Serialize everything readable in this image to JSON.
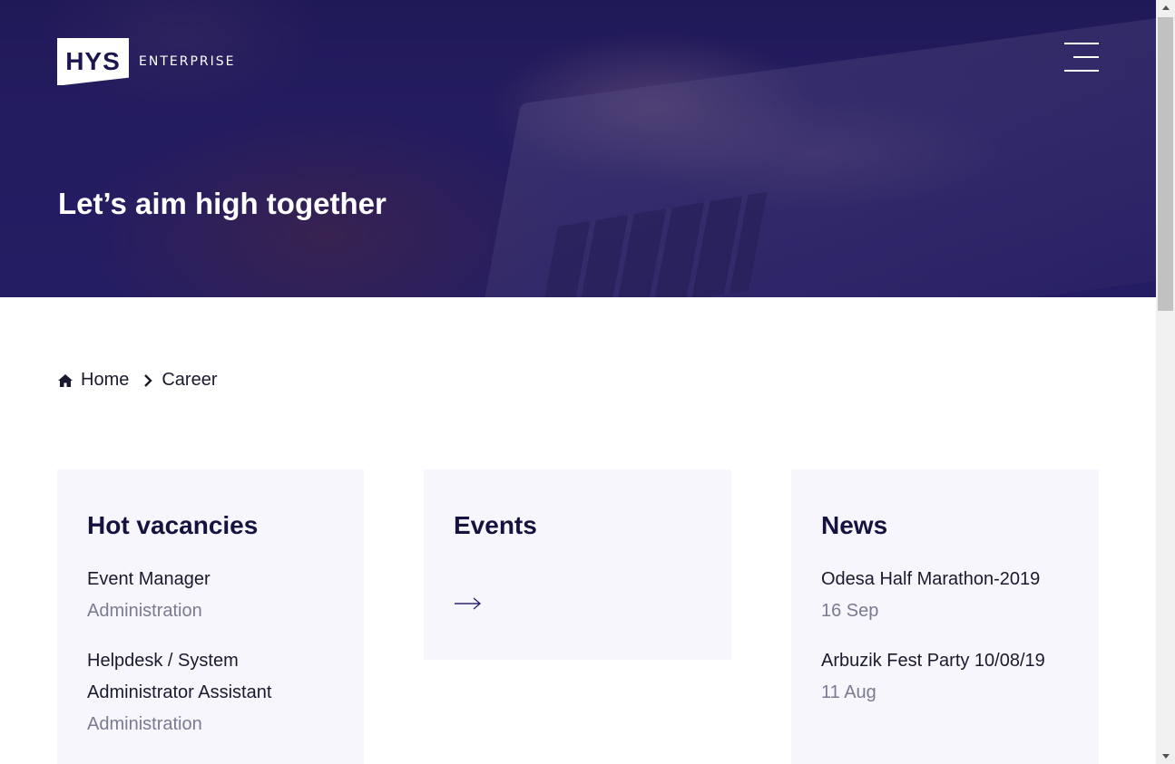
{
  "header": {
    "logo_mark": "HYS",
    "logo_text": "ENTERPRISE",
    "hero_title": "Let’s aim high together"
  },
  "breadcrumb": {
    "home_label": "Home",
    "current_label": "Career"
  },
  "vacancies": {
    "title": "Hot vacancies",
    "items": [
      {
        "title": "Event Manager",
        "department": "Administration"
      },
      {
        "title_line1": "Helpdesk / System",
        "title_line2": "Administrator Assistant",
        "department": "Administration"
      }
    ]
  },
  "events": {
    "title": "Events",
    "link_icon": "arrow-right-icon"
  },
  "news": {
    "title": "News",
    "items": [
      {
        "title": "Odesa Half Marathon-2019",
        "date": "16 Sep"
      },
      {
        "title": "Arbuzik Fest Party 10/08/19",
        "date": "11 Aug"
      }
    ]
  },
  "colors": {
    "hero_overlay": "#211a5a",
    "card_background": "#f7f6fd",
    "heading": "#14123f",
    "muted_text": "#7a7a90"
  }
}
